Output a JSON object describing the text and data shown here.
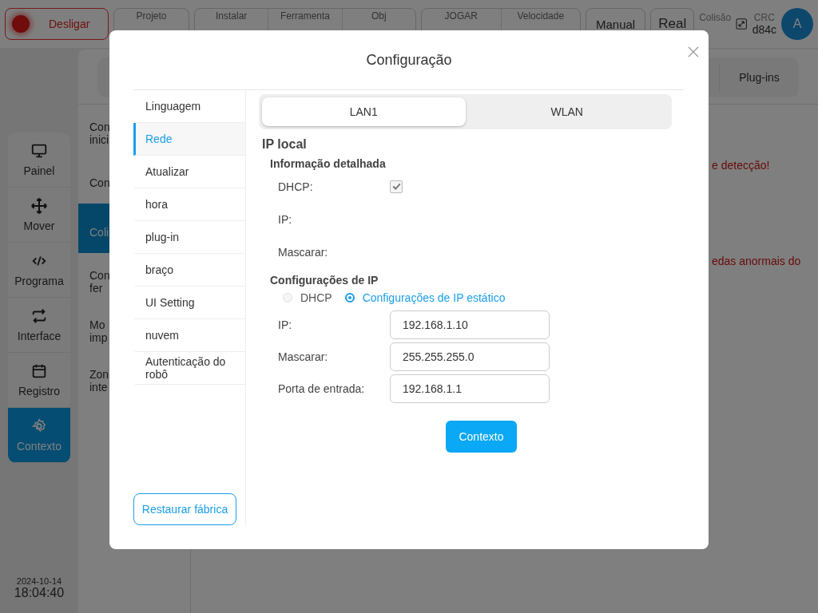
{
  "top_bar": {
    "power_button": "Desligar",
    "groups": [
      {
        "fields": [
          {
            "label": "Projeto"
          }
        ]
      },
      {
        "fields": [
          {
            "label": "Instalar"
          },
          {
            "label": "Ferramenta"
          },
          {
            "label": "Obj"
          }
        ]
      },
      {
        "fields": [
          {
            "label": "JOGAR"
          },
          {
            "label": "Velocidade"
          }
        ]
      }
    ],
    "mode_buttons": [
      "Manual",
      "Real"
    ],
    "collision": {
      "label": "Colisão"
    },
    "crc": {
      "label": "CRC",
      "value": "d84c"
    },
    "avatar": "A"
  },
  "nav": [
    {
      "label": "Painel",
      "selected": false
    },
    {
      "label": "Mover",
      "selected": false
    },
    {
      "label": "Programa",
      "selected": false
    },
    {
      "label": "Interface",
      "selected": false
    },
    {
      "label": "Registro",
      "selected": false
    },
    {
      "label": "Contexto",
      "selected": true
    }
  ],
  "datetime": {
    "date": "2024-10-14",
    "time": "18:04:40"
  },
  "tab_bar": [
    "Plug-ins"
  ],
  "settings_list": [
    {
      "label": "Con inici",
      "selected": false
    },
    {
      "label": "Con",
      "selected": false
    },
    {
      "label": "Coli",
      "selected": true
    },
    {
      "label": "Con fer",
      "selected": false
    },
    {
      "label": "Mo imp",
      "selected": false
    },
    {
      "label": "Zon inte",
      "selected": false
    }
  ],
  "messages": [
    "e detecção!",
    "edas anormais do"
  ],
  "dialog": {
    "title": "Configuração",
    "menu": [
      {
        "label": "Linguagem",
        "selected": false
      },
      {
        "label": "Rede",
        "selected": true
      },
      {
        "label": "Atualizar",
        "selected": false
      },
      {
        "label": "hora",
        "selected": false
      },
      {
        "label": "plug-in",
        "selected": false
      },
      {
        "label": "braço",
        "selected": false
      },
      {
        "label": "UI Setting",
        "selected": false
      },
      {
        "label": "nuvem",
        "selected": false
      },
      {
        "label": "Autenticação do robô",
        "selected": false
      }
    ],
    "reset_button": "Restaurar fábrica",
    "tabs": [
      {
        "label": "LAN1",
        "selected": true
      },
      {
        "label": "WLAN",
        "selected": false
      }
    ],
    "section_title": "IP local",
    "details": {
      "title": "Informação detalhada",
      "dhcp": {
        "label": "DHCP:",
        "checked": true,
        "disabled": true
      },
      "ip": {
        "label": "IP:"
      },
      "mask": {
        "label": "Mascarar:"
      }
    },
    "ip_settings": {
      "title": "Configurações de IP",
      "modes": [
        {
          "label": "DHCP",
          "selected": false,
          "disabled": true
        },
        {
          "label": "Configurações de IP estático",
          "selected": true,
          "disabled": false
        }
      ],
      "fields": [
        {
          "label": "IP:",
          "value": "192.168.1.10"
        },
        {
          "label": "Mascarar:",
          "value": "255.255.255.0"
        },
        {
          "label": "Porta de entrada:",
          "value": "192.168.1.1"
        }
      ]
    },
    "submit_button": "Contexto"
  }
}
